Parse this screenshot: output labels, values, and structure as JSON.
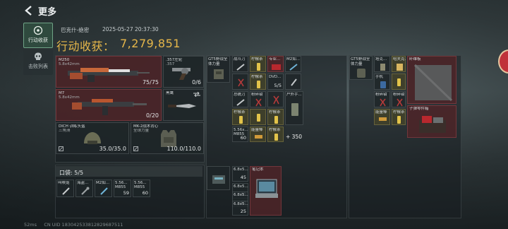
{
  "header": {
    "title": "更多"
  },
  "nav": [
    {
      "label": "行动收获"
    },
    {
      "label": "击败列表"
    }
  ],
  "meta": {
    "map": "巴克什-绝密",
    "timestamp": "2025-05-27 20:37:30"
  },
  "haul": {
    "label": "行动收获：",
    "value": "7,279,851"
  },
  "gear": {
    "primary": {
      "name": "M250",
      "sub": "5.8x42mm",
      "count": "75/75"
    },
    "pistol": {
      "name": ".357左轮",
      "sub": ".357",
      "count": "0/6"
    },
    "secondary": {
      "name": "M7",
      "sub": "5.8x42mm",
      "count": "0/20"
    },
    "melee": {
      "name": "黑鹰"
    },
    "helmet": {
      "name": "DICH 训练头盔",
      "sub": "三角洲",
      "count": "35.0/35.0"
    },
    "armor": {
      "name": "MK-2战术背心",
      "sub": "全球力量",
      "count": "110.0/110.0"
    }
  },
  "pocket": {
    "title": "口袋: 5/5",
    "items": [
      {
        "name": "叫唤笼",
        "count": ""
      },
      {
        "name": "海盗...",
        "count": ""
      },
      {
        "name": "M2如...",
        "count": ""
      },
      {
        "name": "5.56...",
        "sub": "M855",
        "count": "59"
      },
      {
        "name": "5.56...",
        "sub": "M855",
        "count": "60"
      }
    ]
  },
  "rig": {
    "label": "GT5野战全体力量",
    "items": [
      {
        "name": "战斗刀",
        "count": ""
      },
      {
        "name": "柠檬茶",
        "count": ""
      },
      {
        "name": "专业...",
        "count": ""
      },
      {
        "name": "M2如...",
        "count": ""
      },
      {
        "name": "柠檬茶",
        "count": ""
      },
      {
        "name": "DVD...",
        "count": "5/5"
      },
      {
        "name": "总统刀",
        "count": ""
      },
      {
        "name": "粉碎钳",
        "count": ""
      },
      {
        "name": "户外手...",
        "count": ""
      },
      {
        "name": "柠檬茶",
        "count": ""
      },
      {
        "name": "柠檬茶",
        "count": ""
      },
      {
        "name": "5.56x...",
        "sub": "M855",
        "count": "60"
      },
      {
        "name": "能量棒",
        "count": ""
      },
      {
        "name": "柠檬茶",
        "count": ""
      }
    ],
    "plus": "+ 350"
  },
  "bag": {
    "label": "GT5野战全体力量",
    "items": [
      {
        "name": "塔克...",
        "count": ""
      },
      {
        "name": "哈夫克...",
        "count": ""
      },
      {
        "name": "纤维板",
        "count": ""
      },
      {
        "name": "手机",
        "count": ""
      },
      {
        "name": "粉碎钳",
        "count": ""
      },
      {
        "name": "粉碎钳",
        "count": ""
      },
      {
        "name": "子弹零件箱",
        "count": ""
      },
      {
        "name": "能量棒",
        "count": ""
      },
      {
        "name": "柠檬茶",
        "count": ""
      }
    ]
  },
  "case": {
    "items": [
      {
        "name": "6.8x5...",
        "count": "45"
      },
      {
        "name": "笔记本",
        "count": ""
      },
      {
        "name": "6.8x5...",
        "count": "60"
      },
      {
        "name": "6.8x5...",
        "count": "60"
      },
      {
        "name": "6.8x5...",
        "count": "25"
      }
    ]
  },
  "footer": {
    "ping": "52ms",
    "uid": "CN UID 183042533812829687511"
  },
  "colors": {
    "accent_gold": "#e6b74a",
    "active_nav": "#2f4a3e",
    "red_slot": "#4e2428"
  }
}
